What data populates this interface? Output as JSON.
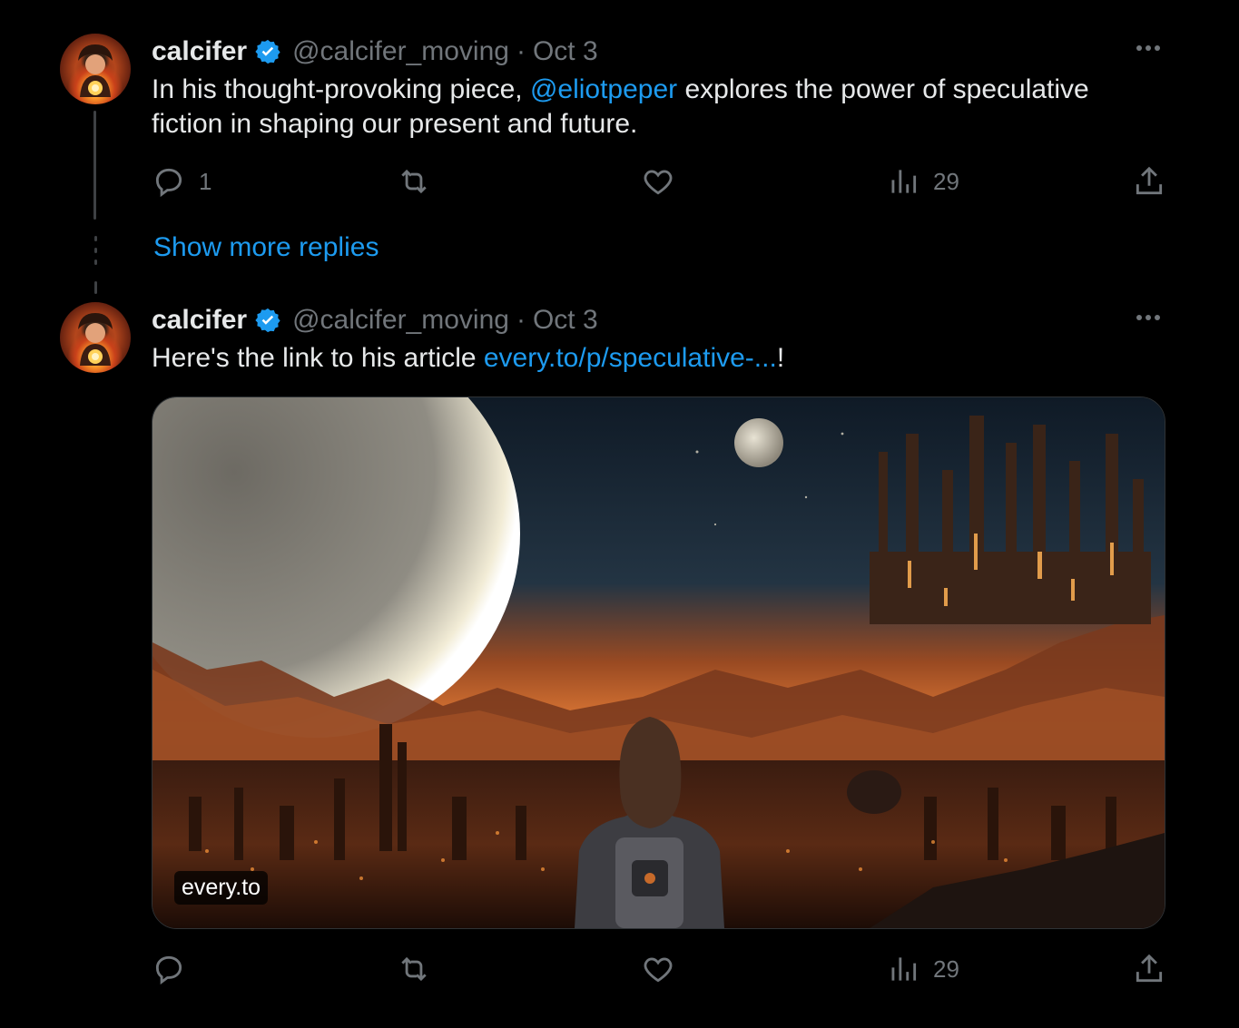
{
  "tweet1": {
    "name": "calcifer",
    "handle": "@calcifer_moving",
    "sep": "·",
    "date": "Oct 3",
    "text_before": "In his thought-provoking piece, ",
    "mention": "@eliotpeper",
    "text_after": " explores the power of speculative fiction in shaping our present and future.",
    "replies": "1",
    "reposts": "",
    "likes": "",
    "views": "29"
  },
  "show_more": "Show more replies",
  "tweet2": {
    "name": "calcifer",
    "handle": "@calcifer_moving",
    "sep": "·",
    "date": "Oct 3",
    "text_before": "Here's the link to his article ",
    "link": "every.to/p/speculative-...",
    "text_after": "!",
    "card_domain": "every.to",
    "replies": "",
    "reposts": "",
    "likes": "",
    "views": "29"
  },
  "colors": {
    "accent": "#1d9bf0",
    "muted": "#71767b",
    "text": "#e7e9ea",
    "background": "#000000"
  }
}
